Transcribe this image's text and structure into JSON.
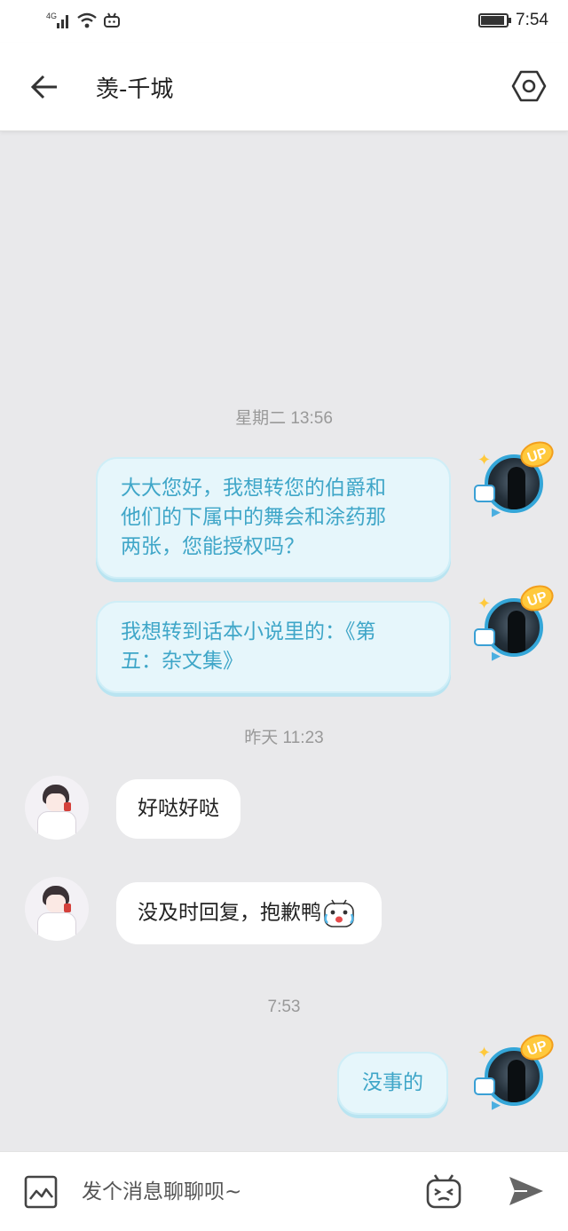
{
  "status_bar": {
    "network": "4G",
    "time": "7:54",
    "battery_level": 0.85
  },
  "header": {
    "title": "羡-千城",
    "back_icon": "arrow-left-icon",
    "settings_icon": "hexagon-settings-icon"
  },
  "messages": [
    {
      "type": "timestamp",
      "text": "星期二 13:56"
    },
    {
      "type": "outgoing",
      "text": "大大您好，我想转您的伯爵和\n他们的下属中的舞会和涂药那\n两张，您能授权吗？"
    },
    {
      "type": "outgoing",
      "text": "我想转到话本小说里的：《第\n五：杂文集》"
    },
    {
      "type": "timestamp",
      "text": "昨天 11:23"
    },
    {
      "type": "incoming",
      "text": "好哒好哒"
    },
    {
      "type": "incoming",
      "text": "没及时回复，抱歉鸭",
      "emoji": "crying-tv-emoji"
    },
    {
      "type": "timestamp",
      "text": "7:53"
    },
    {
      "type": "outgoing",
      "text": "没事的"
    }
  ],
  "input_bar": {
    "placeholder": "发个消息聊聊呗~",
    "image_icon": "image-icon",
    "emoji_icon": "tv-emoji-icon",
    "send_icon": "send-icon"
  },
  "colors": {
    "outgoing_bubble_bg": "#e6f6fb",
    "outgoing_text": "#3fa6c8",
    "incoming_bubble_bg": "#ffffff",
    "chat_bg": "#e9e9eb"
  }
}
